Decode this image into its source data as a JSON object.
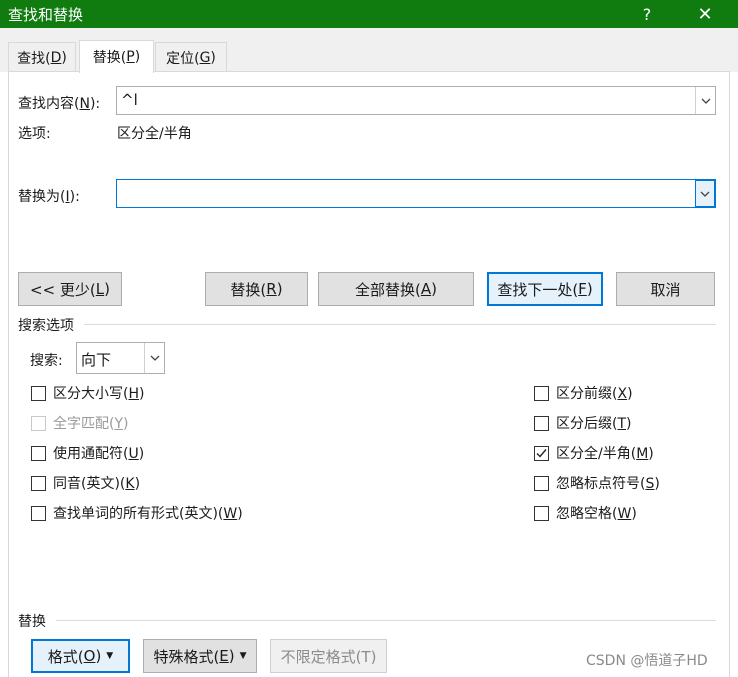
{
  "window": {
    "title": "查找和替换",
    "help_glyph": "?",
    "close_glyph": "✕"
  },
  "tabs": [
    {
      "label": "查找(",
      "key": "D",
      "suffix": ")",
      "active": false
    },
    {
      "label": "替换(",
      "key": "P",
      "suffix": ")",
      "active": true
    },
    {
      "label": "定位(",
      "key": "G",
      "suffix": ")",
      "active": false
    }
  ],
  "find": {
    "label_pre": "查找内容(",
    "label_key": "N",
    "label_post": "):",
    "value": "^l"
  },
  "options": {
    "label": "选项:",
    "value": "区分全/半角"
  },
  "replace": {
    "label_pre": "替换为(",
    "label_key": "I",
    "label_post": "):",
    "value": ""
  },
  "buttons": {
    "less": {
      "pre": "<< 更少(",
      "key": "L",
      "post": ")"
    },
    "replace": {
      "pre": "替换(",
      "key": "R",
      "post": ")"
    },
    "replace_all": {
      "pre": "全部替换(",
      "key": "A",
      "post": ")"
    },
    "find_next": {
      "pre": "查找下一处(",
      "key": "F",
      "post": ")"
    },
    "cancel": "取消"
  },
  "search_options": {
    "group_label": "搜索选项",
    "direction_label": "搜索:",
    "direction_value": "向下",
    "left": [
      {
        "pre": "区分大小写(",
        "key": "H",
        "post": ")",
        "checked": false,
        "disabled": false
      },
      {
        "pre": "全字匹配(",
        "key": "Y",
        "post": ")",
        "checked": false,
        "disabled": true
      },
      {
        "pre": "使用通配符(",
        "key": "U",
        "post": ")",
        "checked": false,
        "disabled": false
      },
      {
        "pre": "同音(英文)(",
        "key": "K",
        "post": ")",
        "checked": false,
        "disabled": false
      },
      {
        "pre": "查找单词的所有形式(英文)(",
        "key": "W",
        "post": ")",
        "checked": false,
        "disabled": false
      }
    ],
    "right": [
      {
        "pre": "区分前缀(",
        "key": "X",
        "post": ")",
        "checked": false
      },
      {
        "pre": "区分后缀(",
        "key": "T",
        "post": ")",
        "checked": false
      },
      {
        "pre": "区分全/半角(",
        "key": "M",
        "post": ")",
        "checked": true
      },
      {
        "pre": "忽略标点符号(",
        "key": "S",
        "post": ")",
        "checked": false
      },
      {
        "pre": "忽略空格(",
        "key": "W",
        "post": ")",
        "checked": false
      }
    ]
  },
  "replace_group": {
    "label": "替换",
    "format": {
      "pre": "格式(",
      "key": "O",
      "post": ")"
    },
    "special": {
      "pre": "特殊格式(",
      "key": "E",
      "post": ")"
    },
    "no_format": "不限定格式(T)"
  },
  "watermark": "CSDN @悟道子HD"
}
